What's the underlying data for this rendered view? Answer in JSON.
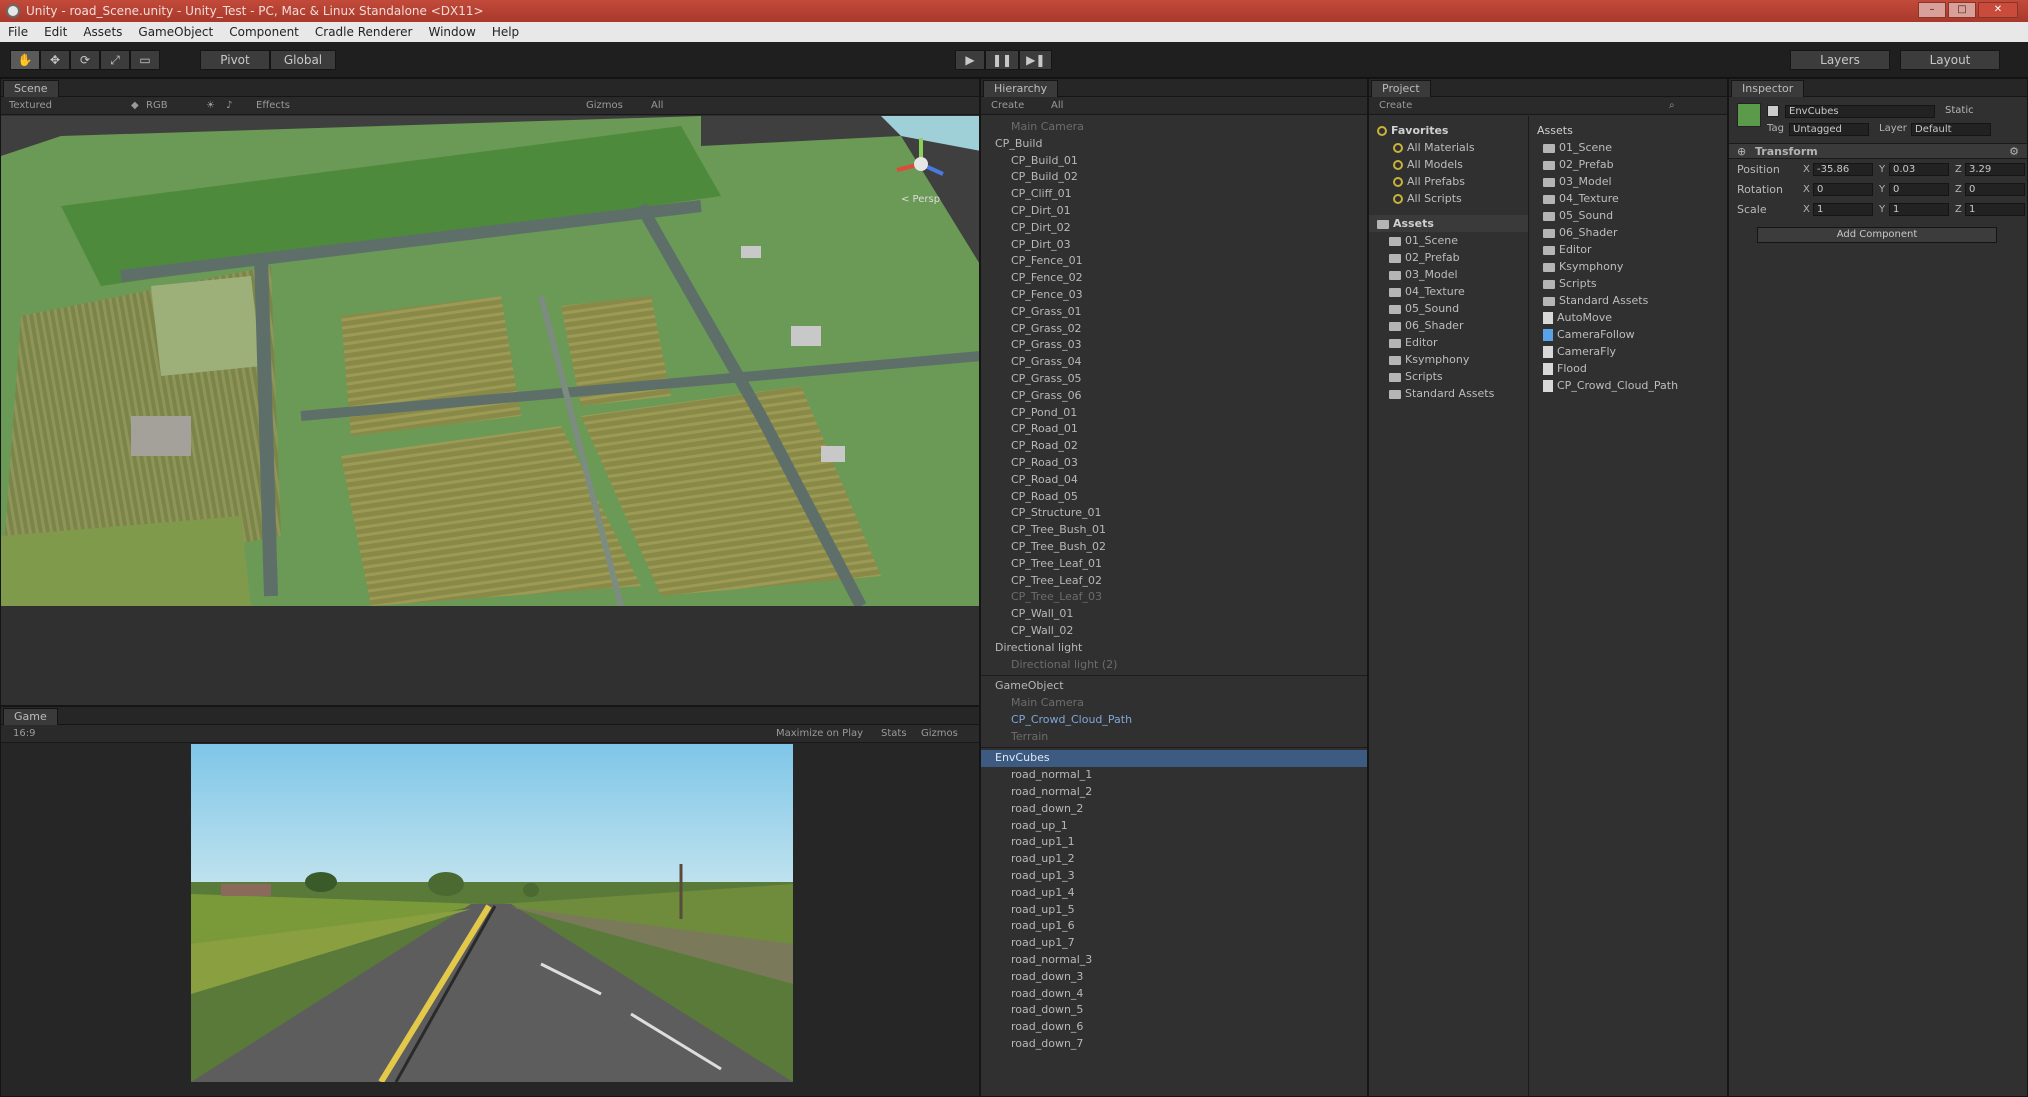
{
  "window": {
    "title": "Unity - road_Scene.unity - Unity_Test - PC, Mac & Linux Standalone <DX11>",
    "controls": [
      "–",
      "□",
      "✕"
    ]
  },
  "menu": [
    "File",
    "Edit",
    "Assets",
    "GameObject",
    "Component",
    "Cradle Renderer",
    "Window",
    "Help"
  ],
  "toolbar": {
    "transform_tools": [
      "hand-icon",
      "move-icon",
      "rotate-icon",
      "scale-icon",
      "rect-icon"
    ],
    "pivot_label": "Pivot",
    "global_label": "Global",
    "layers_label": "Layers",
    "layout_label": "Layout"
  },
  "scene": {
    "tab": "Scene",
    "shading": "Textured",
    "rgb": "RGB",
    "effects": "Effects",
    "gizmos": "Gizmos",
    "search": "All",
    "persp_label": "< Persp"
  },
  "game": {
    "tab": "Game",
    "aspect": "16:9",
    "maximize": "Maximize on Play",
    "stats": "Stats",
    "gizmos": "Gizmos"
  },
  "hierarchy": {
    "tab": "Hierarchy",
    "create": "Create",
    "search": "All",
    "rows": [
      {
        "text": "Main Camera",
        "kind": "dim"
      },
      {
        "text": "CP_Build",
        "kind": "parent"
      },
      {
        "text": "CP_Build_01",
        "kind": "child"
      },
      {
        "text": "CP_Build_02",
        "kind": "child"
      },
      {
        "text": "CP_Cliff_01",
        "kind": "child"
      },
      {
        "text": "CP_Dirt_01",
        "kind": "child"
      },
      {
        "text": "CP_Dirt_02",
        "kind": "child"
      },
      {
        "text": "CP_Dirt_03",
        "kind": "child"
      },
      {
        "text": "CP_Fence_01",
        "kind": "child"
      },
      {
        "text": "CP_Fence_02",
        "kind": "child"
      },
      {
        "text": "CP_Fence_03",
        "kind": "child"
      },
      {
        "text": "CP_Grass_01",
        "kind": "child"
      },
      {
        "text": "CP_Grass_02",
        "kind": "child"
      },
      {
        "text": "CP_Grass_03",
        "kind": "child"
      },
      {
        "text": "CP_Grass_04",
        "kind": "child"
      },
      {
        "text": "CP_Grass_05",
        "kind": "child"
      },
      {
        "text": "CP_Grass_06",
        "kind": "child"
      },
      {
        "text": "CP_Pond_01",
        "kind": "child"
      },
      {
        "text": "CP_Road_01",
        "kind": "child"
      },
      {
        "text": "CP_Road_02",
        "kind": "child"
      },
      {
        "text": "CP_Road_03",
        "kind": "child"
      },
      {
        "text": "CP_Road_04",
        "kind": "child"
      },
      {
        "text": "CP_Road_05",
        "kind": "child"
      },
      {
        "text": "CP_Structure_01",
        "kind": "child"
      },
      {
        "text": "CP_Tree_Bush_01",
        "kind": "child"
      },
      {
        "text": "CP_Tree_Bush_02",
        "kind": "child"
      },
      {
        "text": "CP_Tree_Leaf_01",
        "kind": "child"
      },
      {
        "text": "CP_Tree_Leaf_02",
        "kind": "child"
      },
      {
        "text": "CP_Tree_Leaf_03",
        "kind": "dim"
      },
      {
        "text": "CP_Wall_01",
        "kind": "child"
      },
      {
        "text": "CP_Wall_02",
        "kind": "child"
      },
      {
        "text": "Directional light",
        "kind": "parent"
      },
      {
        "text": "Directional light (2)",
        "kind": "dim"
      },
      {
        "text": "GameObject",
        "kind": "parent"
      },
      {
        "text": "Main Camera",
        "kind": "dim"
      },
      {
        "text": "CP_Crowd_Cloud_Path",
        "kind": "prefab"
      },
      {
        "text": "Terrain",
        "kind": "dim"
      },
      {
        "text": "EnvCubes",
        "kind": "sel"
      },
      {
        "text": "road_normal_1",
        "kind": "child"
      },
      {
        "text": "road_normal_2",
        "kind": "child"
      },
      {
        "text": "road_down_2",
        "kind": "child"
      },
      {
        "text": "road_up_1",
        "kind": "child"
      },
      {
        "text": "road_up1_1",
        "kind": "child"
      },
      {
        "text": "road_up1_2",
        "kind": "child"
      },
      {
        "text": "road_up1_3",
        "kind": "child"
      },
      {
        "text": "road_up1_4",
        "kind": "child"
      },
      {
        "text": "road_up1_5",
        "kind": "child"
      },
      {
        "text": "road_up1_6",
        "kind": "child"
      },
      {
        "text": "road_up1_7",
        "kind": "child"
      },
      {
        "text": "road_normal_3",
        "kind": "child"
      },
      {
        "text": "road_down_3",
        "kind": "child"
      },
      {
        "text": "road_down_4",
        "kind": "child"
      },
      {
        "text": "road_down_5",
        "kind": "child"
      },
      {
        "text": "road_down_6",
        "kind": "child"
      },
      {
        "text": "road_down_7",
        "kind": "child"
      }
    ]
  },
  "project": {
    "tab": "Project",
    "create": "Create",
    "favorites_label": "Favorites",
    "favorites": [
      "All Materials",
      "All Models",
      "All Prefabs",
      "All Scripts"
    ],
    "assets_label": "Assets",
    "tree_folders": [
      "01_Scene",
      "02_Prefab",
      "03_Model",
      "04_Texture",
      "05_Sound",
      "06_Shader",
      "Editor",
      "Ksymphony",
      "Scripts",
      "Standard Assets"
    ],
    "breadcrumb": "Assets",
    "grid_items": [
      {
        "name": "01_Scene",
        "icon": "folder"
      },
      {
        "name": "02_Prefab",
        "icon": "folder"
      },
      {
        "name": "03_Model",
        "icon": "folder"
      },
      {
        "name": "04_Texture",
        "icon": "folder"
      },
      {
        "name": "05_Sound",
        "icon": "folder"
      },
      {
        "name": "06_Shader",
        "icon": "folder"
      },
      {
        "name": "Editor",
        "icon": "folder"
      },
      {
        "name": "Ksymphony",
        "icon": "folder"
      },
      {
        "name": "Scripts",
        "icon": "folder"
      },
      {
        "name": "Standard Assets",
        "icon": "folder"
      },
      {
        "name": "AutoMove",
        "icon": "script"
      },
      {
        "name": "CameraFollow",
        "icon": "script-blue"
      },
      {
        "name": "CameraFly",
        "icon": "script"
      },
      {
        "name": "Flood",
        "icon": "script"
      },
      {
        "name": "CP_Crowd_Cloud_Path",
        "icon": "script"
      }
    ]
  },
  "inspector": {
    "tab": "Inspector",
    "object_name": "EnvCubes",
    "static_label": "Static",
    "tag_label": "Tag",
    "tag_value": "Untagged",
    "layer_label": "Layer",
    "layer_value": "Default",
    "component": "Transform",
    "rows": [
      {
        "label": "Position",
        "x": "-35.86",
        "y": "0.03",
        "z": "3.29"
      },
      {
        "label": "Rotation",
        "x": "0",
        "y": "0",
        "z": "0"
      },
      {
        "label": "Scale",
        "x": "1",
        "y": "1",
        "z": "1"
      }
    ],
    "add_component": "Add Component"
  }
}
